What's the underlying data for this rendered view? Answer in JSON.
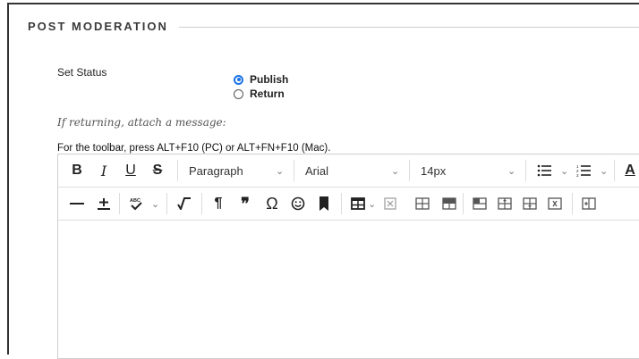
{
  "section": {
    "title": "POST MODERATION"
  },
  "status": {
    "label": "Set Status",
    "options": [
      {
        "label": "Publish",
        "checked": true
      },
      {
        "label": "Return",
        "checked": false
      }
    ]
  },
  "hint": "If returning, attach a message:",
  "toolbar_note": "For the toolbar, press ALT+F10 (PC) or ALT+FN+F10 (Mac).",
  "editor": {
    "row1": {
      "bold": "B",
      "italic": "I",
      "underline": "U",
      "strike": "S",
      "paragraph": "Paragraph",
      "font": "Arial",
      "size": "14px",
      "text_color": "A"
    },
    "row2": {
      "omega": "Ω",
      "quote": "❞",
      "pilcrow": "¶"
    },
    "content": ""
  },
  "colors": {
    "accent": "#1a73e8",
    "border": "#cfcfcf"
  }
}
